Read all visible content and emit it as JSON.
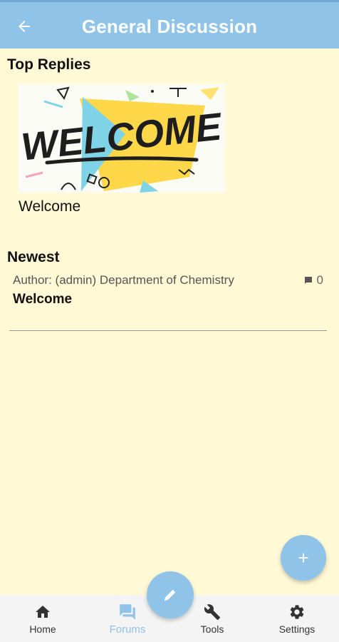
{
  "header": {
    "title": "General Discussion",
    "back_icon": "arrow-back-icon"
  },
  "top_replies": {
    "heading": "Top Replies",
    "items": [
      {
        "image_text": "WELCOME",
        "caption": "Welcome"
      }
    ]
  },
  "newest": {
    "heading": "Newest",
    "posts": [
      {
        "author": "Author: (admin) Department of Chemistry",
        "title": "Welcome",
        "comments": "0",
        "comment_icon": "comment-icon"
      }
    ]
  },
  "fab": {
    "add_icon": "plus-icon",
    "compose_icon": "pencil-icon"
  },
  "bottom_nav": {
    "items": [
      {
        "label": "Home",
        "icon": "home-icon",
        "active": false
      },
      {
        "label": "Forums",
        "icon": "forum-icon",
        "active": true
      },
      {
        "label": "Tools",
        "icon": "wrench-icon",
        "active": false
      },
      {
        "label": "Settings",
        "icon": "gear-icon",
        "active": false
      }
    ]
  },
  "colors": {
    "accent": "#8fc4e8",
    "background": "#fff9d6",
    "nav_background": "#f4f4f4"
  }
}
